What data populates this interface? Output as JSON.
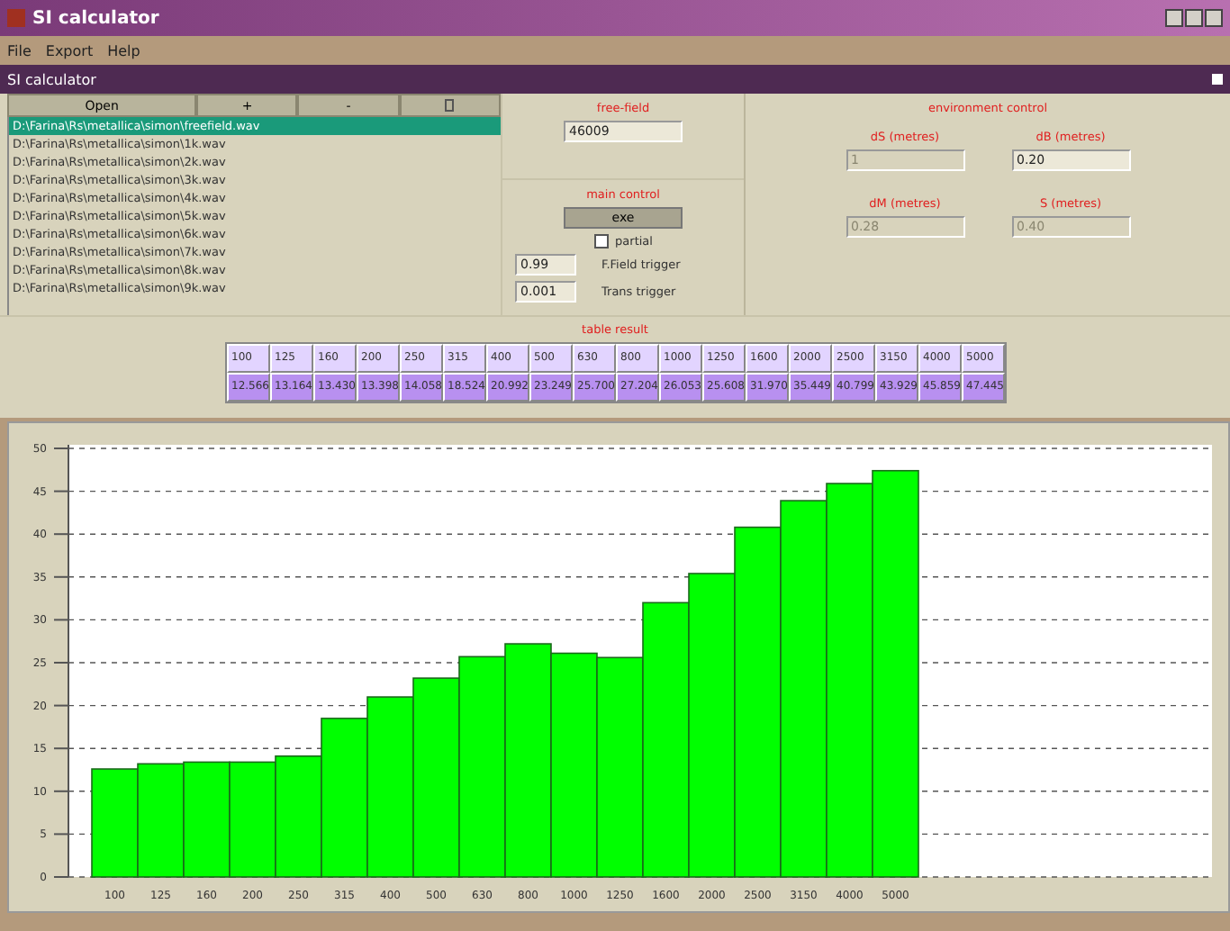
{
  "window": {
    "title": "SI calculator"
  },
  "menu": [
    "File",
    "Export",
    "Help"
  ],
  "panel_title": "SI calculator",
  "toolbar": [
    {
      "kind": "text",
      "label": "Open"
    },
    {
      "kind": "text",
      "label": "+"
    },
    {
      "kind": "text",
      "label": "-"
    },
    {
      "kind": "icon"
    }
  ],
  "files": [
    {
      "path": "D:\\Farina\\Rs\\metallica\\simon\\freefield.wav",
      "selected": true
    },
    {
      "path": "D:\\Farina\\Rs\\metallica\\simon\\1k.wav",
      "selected": false
    },
    {
      "path": "D:\\Farina\\Rs\\metallica\\simon\\2k.wav",
      "selected": false
    },
    {
      "path": "D:\\Farina\\Rs\\metallica\\simon\\3k.wav",
      "selected": false
    },
    {
      "path": "D:\\Farina\\Rs\\metallica\\simon\\4k.wav",
      "selected": false
    },
    {
      "path": "D:\\Farina\\Rs\\metallica\\simon\\5k.wav",
      "selected": false
    },
    {
      "path": "D:\\Farina\\Rs\\metallica\\simon\\6k.wav",
      "selected": false
    },
    {
      "path": "D:\\Farina\\Rs\\metallica\\simon\\7k.wav",
      "selected": false
    },
    {
      "path": "D:\\Farina\\Rs\\metallica\\simon\\8k.wav",
      "selected": false
    },
    {
      "path": "D:\\Farina\\Rs\\metallica\\simon\\9k.wav",
      "selected": false
    }
  ],
  "free_field": {
    "title": "free-field",
    "value": "46009"
  },
  "main_control": {
    "title": "main control",
    "button": "exe",
    "partial": {
      "label": "partial",
      "checked": false
    },
    "triggers": [
      {
        "value": "0.99",
        "label": "F.Field trigger"
      },
      {
        "value": "0.001",
        "label": "Trans trigger"
      }
    ]
  },
  "environment": {
    "title": "environment control",
    "fields": [
      {
        "label": "dS (metres)",
        "value": "1",
        "disabled": true
      },
      {
        "label": "dB (metres)",
        "value": "0.20",
        "disabled": false
      },
      {
        "label": "dM (metres)",
        "value": "0.28",
        "disabled": true
      },
      {
        "label": "S (metres)",
        "value": "0.40",
        "disabled": true
      }
    ]
  },
  "table_result": {
    "title": "table result",
    "frequencies": [
      "100",
      "125",
      "160",
      "200",
      "250",
      "315",
      "400",
      "500",
      "630",
      "800",
      "1000",
      "1250",
      "1600",
      "2000",
      "2500",
      "3150",
      "4000",
      "5000"
    ],
    "values": [
      "12.566",
      "13.164",
      "13.430",
      "13.398",
      "14.058",
      "18.524",
      "20.992",
      "23.249",
      "25.700",
      "27.204",
      "26.053",
      "25.608",
      "31.970",
      "35.449",
      "40.799",
      "43.929",
      "45.859",
      "47.445"
    ]
  },
  "chart": {
    "chart_data": {
      "type": "bar",
      "categories": [
        "100",
        "125",
        "160",
        "200",
        "250",
        "315",
        "400",
        "500",
        "630",
        "800",
        "1000",
        "1250",
        "1600",
        "2000",
        "2500",
        "3150",
        "4000",
        "5000"
      ],
      "series": [
        {
          "color": "#00ff00",
          "values": [
            12.6,
            13.2,
            13.4,
            13.4,
            14.1,
            18.5,
            21.0,
            23.2,
            25.7,
            27.2,
            26.1,
            25.6,
            32.0,
            35.4,
            40.8,
            43.9,
            45.9,
            47.4
          ]
        }
      ],
      "grid": true,
      "ylim": [
        0,
        50
      ],
      "yticks": [
        0,
        5,
        10,
        15,
        20,
        25,
        30,
        35,
        40,
        45,
        50
      ]
    }
  }
}
